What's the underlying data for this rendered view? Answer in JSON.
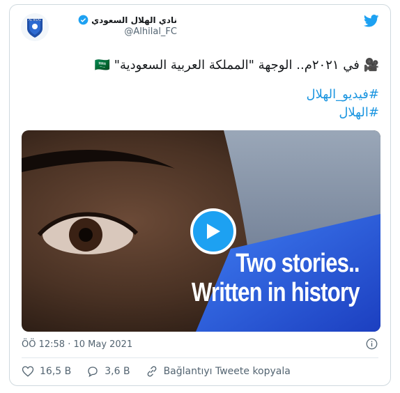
{
  "tweet": {
    "author_name": "نادي الهلال السعودي",
    "handle": "@Alhilal_FC",
    "text_line1": "🎥 في ٢٠٢١م.. الوجهة \"المملكة العربية السعودية\" 🇸🇦",
    "hashtag1": "#فيديو_الهلال",
    "hashtag2": "#الهلال",
    "video_overlay_line1": "Two stories..",
    "video_overlay_line2": "Written in history",
    "timestamp": "ÖÖ 12:58 · 10 May 2021",
    "likes": "16,5 B",
    "replies": "3,6 B",
    "copy_link": "Bağlantıyı Tweete kopyala"
  },
  "colors": {
    "brand": "#1da1f2",
    "hashtag": "#1b95e0",
    "muted": "#536471"
  }
}
